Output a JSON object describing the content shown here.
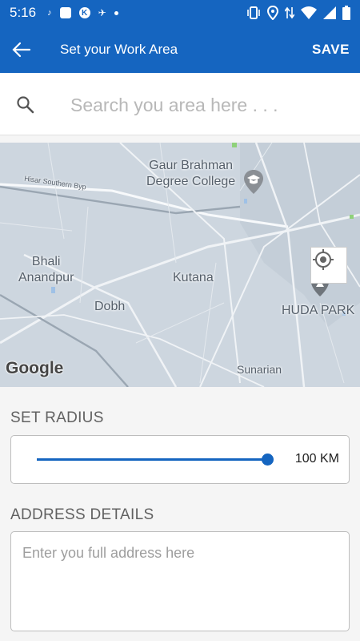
{
  "status_bar": {
    "time": "5:16",
    "left_icons": [
      "dj-icon",
      "square-app-icon",
      "circle-app-icon",
      "plane-icon",
      "dot-icon"
    ],
    "right_icons": [
      "vibrate-icon",
      "location-icon",
      "data-arrows-icon",
      "wifi-icon",
      "signal-icon",
      "battery-icon"
    ]
  },
  "app_bar": {
    "title": "Set your Work Area",
    "save_label": "SAVE",
    "color": "#1565c0"
  },
  "search": {
    "placeholder": "Search you area here . . ."
  },
  "map": {
    "labels": {
      "college": "Gaur Brahman\nDegree College",
      "road": "Hisar Southern Byp",
      "bhali": "Bhali\nAnandpur",
      "kutana": "Kutana",
      "dobh": "Dobh",
      "huda": "HUDA PARK",
      "sunarian": "Sunarian"
    },
    "logo": "Google"
  },
  "radius": {
    "label": "SET RADIUS",
    "value": "100 KM",
    "level": 1.0
  },
  "address": {
    "label": "ADDRESS DETAILS",
    "placeholder": "Enter you full address here"
  }
}
